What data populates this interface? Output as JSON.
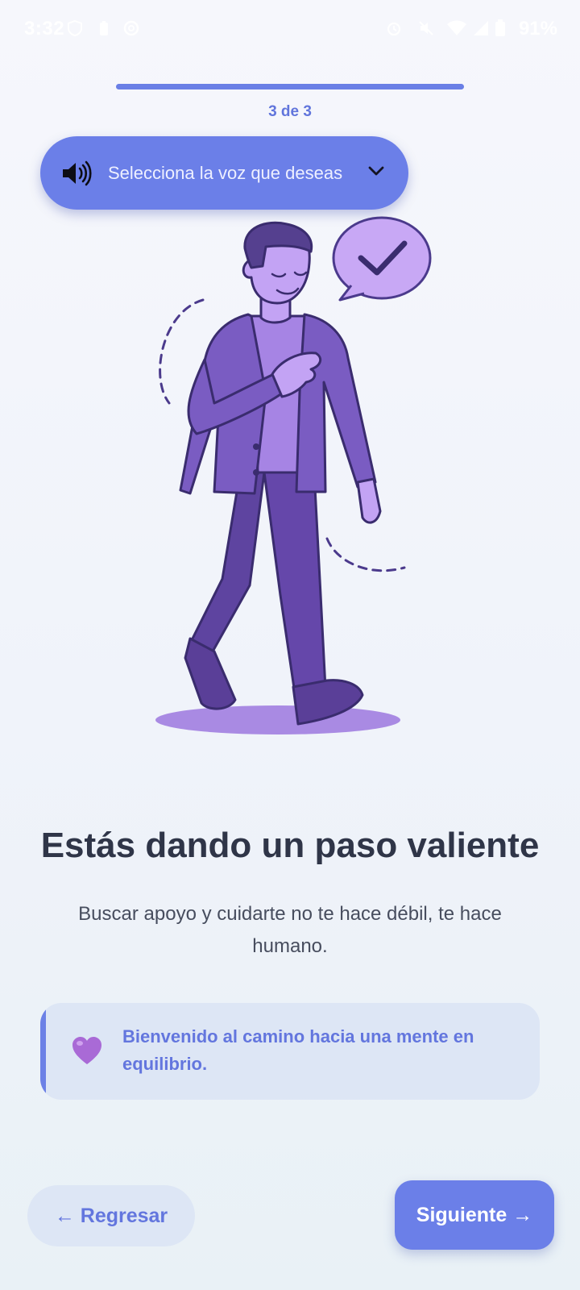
{
  "status_bar": {
    "time": "3:32",
    "battery_percent": "91%",
    "icons": [
      "shield-icon",
      "battery-saver-icon",
      "at-icon",
      "alarm-icon",
      "mute-icon",
      "wifi-icon",
      "signal-icon",
      "battery-icon"
    ]
  },
  "progress": {
    "label": "3 de 3",
    "fraction": 1.0
  },
  "voice_selector": {
    "label": "Selecciona la voz que deseas",
    "icon": "speaker-icon"
  },
  "illustration": {
    "name": "person-walking-illustration"
  },
  "main": {
    "title": "Estás dando un paso valiente",
    "subtitle": "Buscar apoyo y cuidarte no te hace débil, te hace humano."
  },
  "note": {
    "icon": "purple-heart-icon",
    "text": "Bienvenido al camino hacia una mente en equilibrio."
  },
  "buttons": {
    "back": "← Regresar",
    "next": "Siguiente →"
  },
  "colors": {
    "accent": "#6b7fe8",
    "text_accent": "#6376de",
    "title": "#2f3548",
    "illustration_purple": "#7b5cc0"
  }
}
